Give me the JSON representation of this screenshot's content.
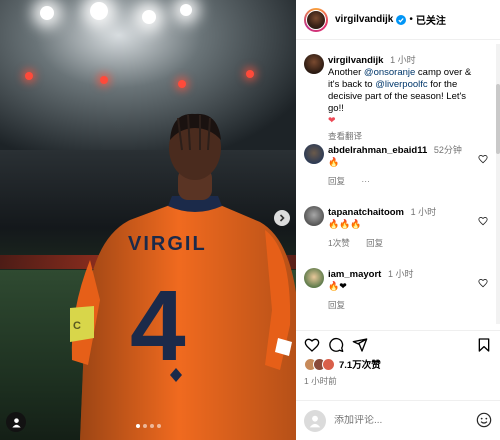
{
  "post": {
    "username": "virgilvandijk",
    "follow_separator": "•",
    "follow_label": "已关注",
    "image_text": {
      "name": "VIRGIL",
      "number": "4",
      "captain_band": "C"
    }
  },
  "caption": {
    "username": "virgilvandijk",
    "time": "1 小时",
    "text_before": "Another ",
    "mention1": "@onsoranje",
    "text_middle": " camp over & it's back to ",
    "mention2": "@liverpoolfc",
    "text_after": " for the decisive part of the season! Let's go!!",
    "emoji": "❤",
    "translate_label": "查看翻译"
  },
  "comments": [
    {
      "username": "abdelrahman_ebaid11",
      "time": "52分钟",
      "text": "🔥",
      "reply_label": "回复",
      "more_label": "···"
    },
    {
      "username": "tapanatchaitoom",
      "time": "1 小时",
      "text": "🔥🔥🔥",
      "likes_label": "1次赞",
      "reply_label": "回复"
    },
    {
      "username": "iam_mayort",
      "time": "1 小时",
      "text": "🔥❤",
      "reply_label": "回复"
    }
  ],
  "likes": {
    "count_label": "7.1万次赞"
  },
  "posted_time": "1 小时前",
  "add_comment": {
    "placeholder": "添加评论..."
  },
  "colors": {
    "verified": "#0095f6",
    "jersey": "#f06a1f",
    "heart": "#ed4956",
    "mention": "#00376b"
  },
  "icons": [
    "verified-badge-icon",
    "heart-icon",
    "comment-icon",
    "share-icon",
    "bookmark-icon",
    "emoji-icon",
    "chevron-right-icon",
    "user-tag-icon"
  ]
}
